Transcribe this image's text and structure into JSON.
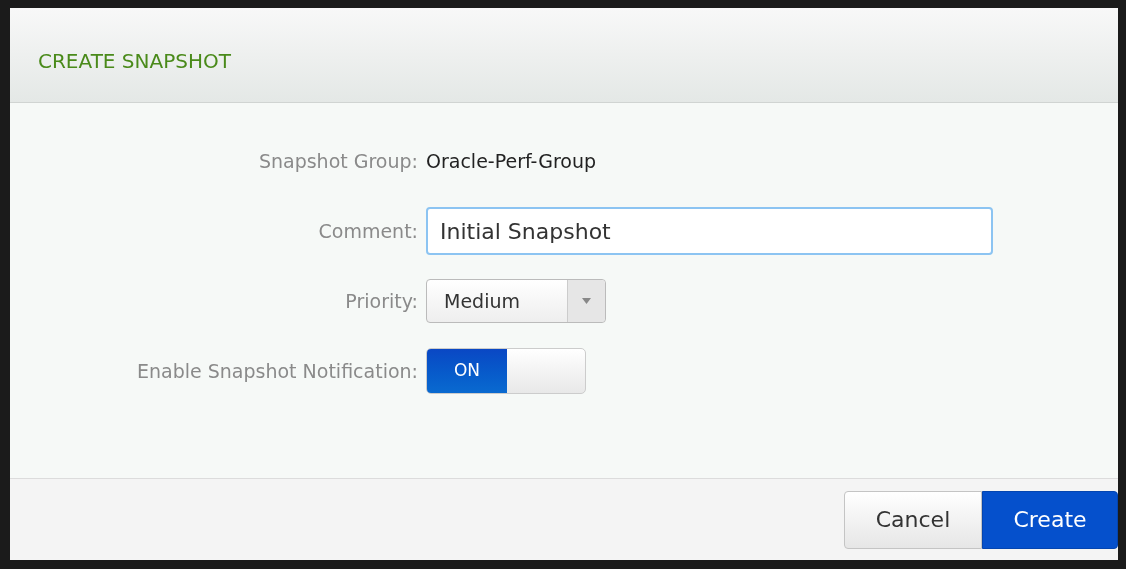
{
  "dialog": {
    "title": "CREATE SNAPSHOT"
  },
  "fields": [
    {
      "kind": "text",
      "label": "Snapshot Group:",
      "value": "Oracle-Perf-Group"
    },
    {
      "kind": "input",
      "label": "Comment:",
      "value": "Initial Snapshot"
    },
    {
      "kind": "select",
      "label": "Priority:",
      "value": "Medium"
    },
    {
      "kind": "toggle",
      "label": "Enable Snapshot Notification:",
      "on": true,
      "value": "ON"
    }
  ],
  "buttons": [
    {
      "label": "Cancel",
      "primary": false
    },
    {
      "label": "Create",
      "primary": true
    }
  ]
}
